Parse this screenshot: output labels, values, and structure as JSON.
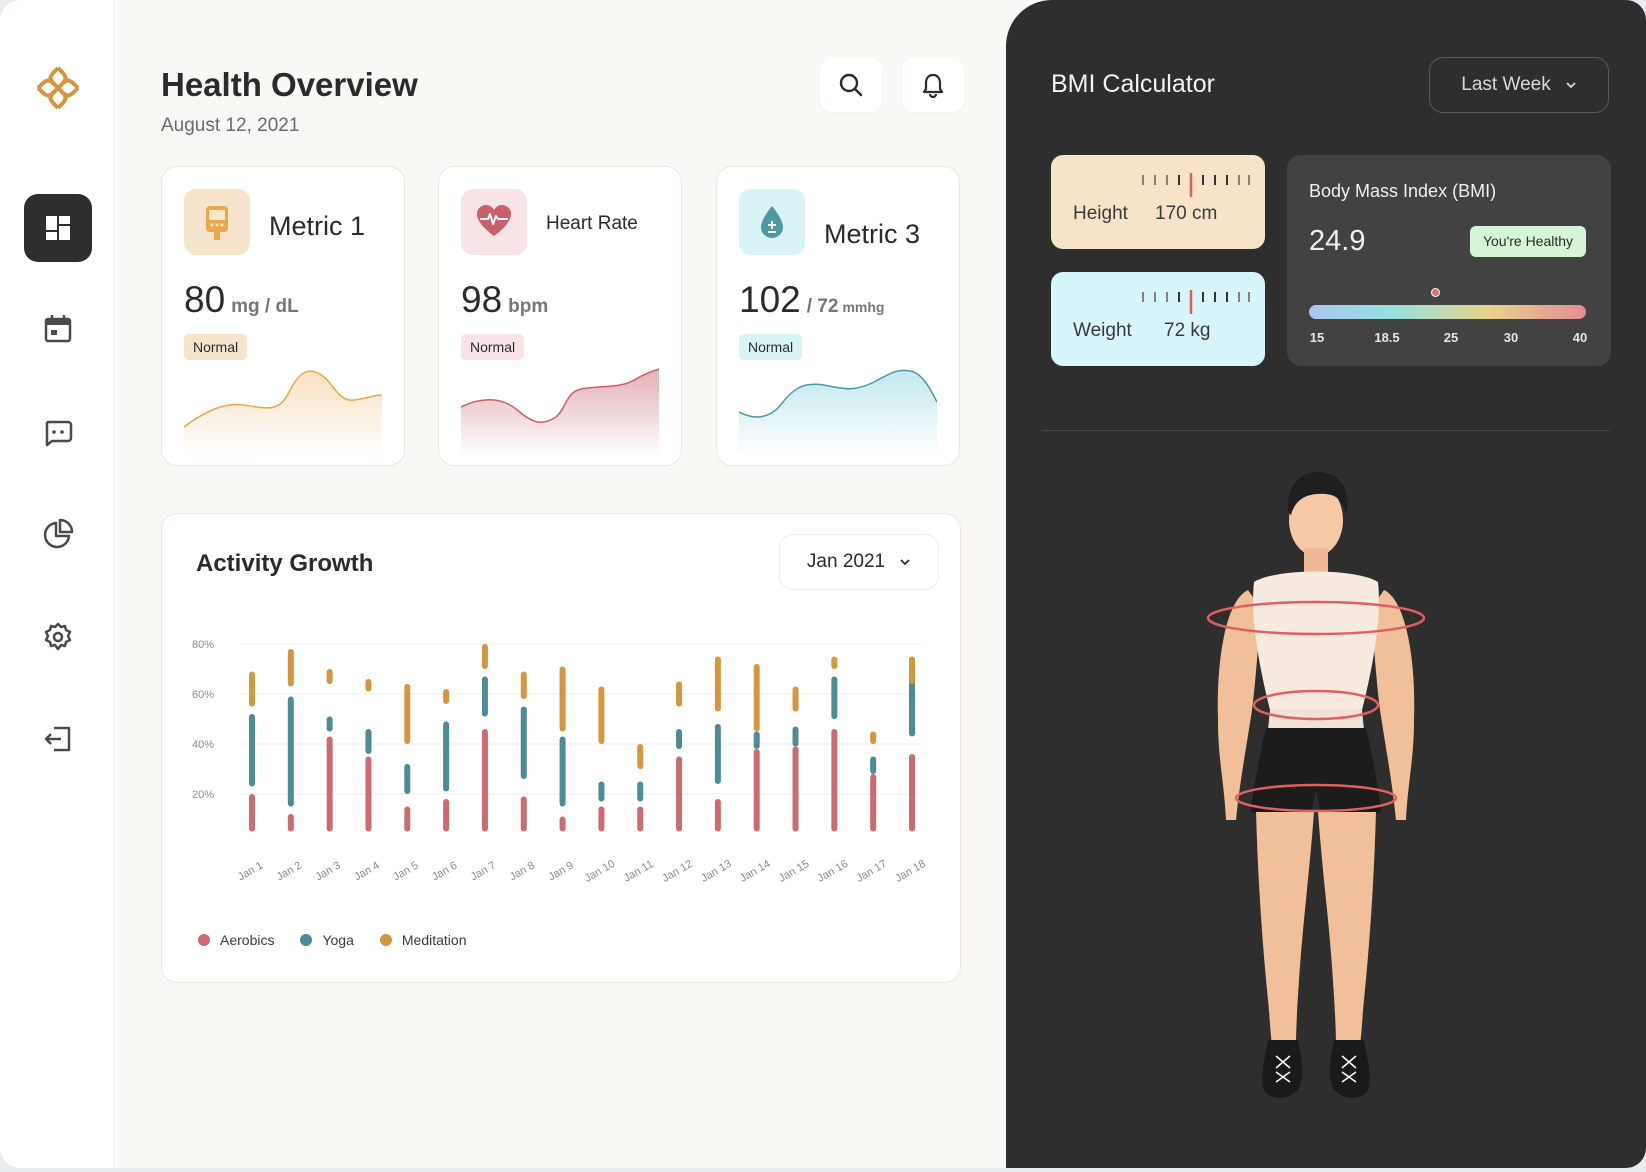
{
  "header": {
    "title": "Health Overview",
    "date": "August 12, 2021"
  },
  "sidebar": {
    "items": [
      {
        "name": "dashboard",
        "active": true
      },
      {
        "name": "calendar",
        "active": false
      },
      {
        "name": "messages",
        "active": false
      },
      {
        "name": "reports",
        "active": false
      },
      {
        "name": "settings",
        "active": false
      },
      {
        "name": "logout",
        "active": false
      }
    ]
  },
  "metrics": [
    {
      "title": "Metric 1",
      "value": "80",
      "unit": "mg / dL",
      "status": "Normal",
      "accent": "#e9a84a",
      "icon": "glucometer-icon"
    },
    {
      "title": "Heart Rate",
      "value": "98",
      "unit": "bpm",
      "status": "Normal",
      "accent": "#c8606a",
      "icon": "heart-pulse-icon"
    },
    {
      "title": "Metric 3",
      "value": "102",
      "unit": "/ 72",
      "unit_small": "mmhg",
      "status": "Normal",
      "accent": "#4f97a3",
      "icon": "blood-drop-icon"
    }
  ],
  "activity": {
    "title": "Activity Growth",
    "period": "Jan 2021"
  },
  "chart_data": {
    "type": "bar",
    "stacked_ranges": true,
    "categories": [
      "Jan 1",
      "Jan 2",
      "Jan 3",
      "Jan 4",
      "Jan 5",
      "Jan 6",
      "Jan 7",
      "Jan 8",
      "Jan 9",
      "Jan 10",
      "Jan 11",
      "Jan 12",
      "Jan 13",
      "Jan 14",
      "Jan 15",
      "Jan 16",
      "Jan 17",
      "Jan 18"
    ],
    "series": [
      {
        "name": "Aerobics",
        "color": "#cc6b72",
        "ranges": [
          [
            5,
            20
          ],
          [
            5,
            12
          ],
          [
            5,
            43
          ],
          [
            5,
            35
          ],
          [
            5,
            15
          ],
          [
            5,
            18
          ],
          [
            5,
            46
          ],
          [
            5,
            19
          ],
          [
            5,
            11
          ],
          [
            5,
            15
          ],
          [
            5,
            15
          ],
          [
            5,
            35
          ],
          [
            5,
            18
          ],
          [
            5,
            38
          ],
          [
            5,
            39
          ],
          [
            5,
            46
          ],
          [
            5,
            28
          ],
          [
            5,
            36
          ]
        ]
      },
      {
        "name": "Yoga",
        "color": "#4f8b95",
        "ranges": [
          [
            23,
            52
          ],
          [
            15,
            59
          ],
          [
            45,
            51
          ],
          [
            36,
            46
          ],
          [
            20,
            32
          ],
          [
            21,
            49
          ],
          [
            51,
            67
          ],
          [
            26,
            55
          ],
          [
            15,
            43
          ],
          [
            17,
            25
          ],
          [
            17,
            25
          ],
          [
            38,
            46
          ],
          [
            24,
            48
          ],
          [
            38,
            45
          ],
          [
            39,
            47
          ],
          [
            50,
            67
          ],
          [
            28,
            35
          ],
          [
            43,
            67
          ]
        ]
      },
      {
        "name": "Meditation",
        "color": "#d4963f",
        "ranges": [
          [
            55,
            69
          ],
          [
            63,
            78
          ],
          [
            64,
            70
          ],
          [
            61,
            66
          ],
          [
            40,
            64
          ],
          [
            56,
            62
          ],
          [
            70,
            80
          ],
          [
            58,
            69
          ],
          [
            45,
            71
          ],
          [
            40,
            63
          ],
          [
            30,
            40
          ],
          [
            55,
            65
          ],
          [
            53,
            75
          ],
          [
            45,
            72
          ],
          [
            53,
            63
          ],
          [
            70,
            75
          ],
          [
            40,
            45
          ],
          [
            64,
            75
          ]
        ]
      }
    ],
    "ytick_labels": [
      "20%",
      "40%",
      "60%",
      "80%"
    ],
    "ylim": [
      0,
      80
    ],
    "grid": true,
    "legend": "bottom-left"
  },
  "bmi": {
    "title": "BMI Calculator",
    "period": "Last Week",
    "height_label": "Height",
    "height_value": "170 cm",
    "weight_label": "Weight",
    "weight_value": "72 kg",
    "card_title": "Body Mass Index (BMI)",
    "value": "24.9",
    "status": "You're Healthy",
    "scale_ticks": [
      "15",
      "18.5",
      "25",
      "30",
      "40"
    ]
  }
}
